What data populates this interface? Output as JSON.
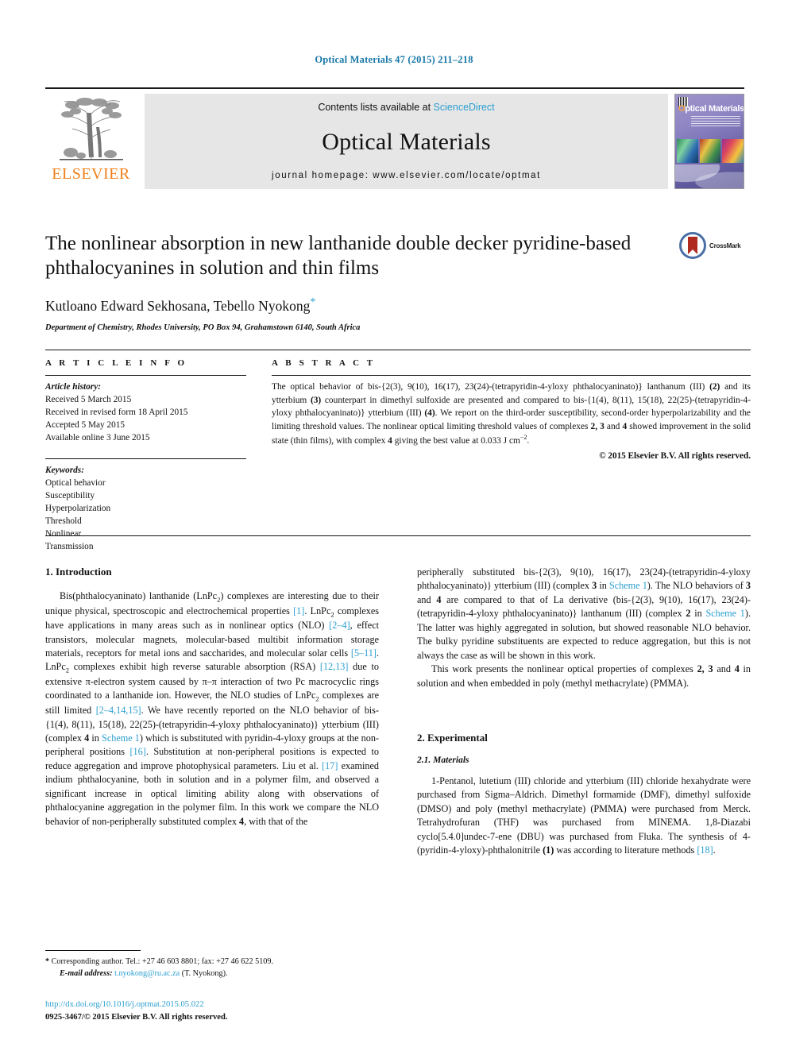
{
  "running_head": "Optical Materials 47 (2015) 211–218",
  "masthead": {
    "publisher_wordmark": "ELSEVIER",
    "contents_prefix": "Contents lists available at ",
    "contents_link": "ScienceDirect",
    "journal_name": "Optical Materials",
    "homepage_line": "journal homepage: www.elsevier.com/locate/optmat",
    "cover_title_o": "O",
    "cover_title_rest": "ptical Materials"
  },
  "crossmark": {
    "label": "CrossMark"
  },
  "title": "The nonlinear absorption in new lanthanide double decker pyridine-based phthalocyanines in solution and thin films",
  "authors": "Kutloano Edward Sekhosana, Tebello Nyokong",
  "affiliation": "Department of Chemistry, Rhodes University, PO Box 94, Grahamstown 6140, South Africa",
  "article_info": {
    "heading": "A R T I C L E   I N F O",
    "history_label": "Article history:",
    "history": [
      "Received 5 March 2015",
      "Received in revised form 18 April 2015",
      "Accepted 5 May 2015",
      "Available online 3 June 2015"
    ],
    "keywords_label": "Keywords:",
    "keywords": [
      "Optical behavior",
      "Susceptibility",
      "Hyperpolarization",
      "Threshold",
      "Nonlinear",
      "Transmission"
    ]
  },
  "abstract": {
    "heading": "A B S T R A C T",
    "text_1": "The optical behavior of bis-{2(3), 9(10), 16(17), 23(24)-(tetrapyridin-4-yloxy phthalocyaninato)} lanthanum (III) ",
    "bold_2": "(2)",
    "text_2": " and its ytterbium ",
    "bold_3": "(3)",
    "text_3": " counterpart in dimethyl sulfoxide are presented and compared to bis-{1(4), 8(11), 15(18), 22(25)-(tetrapyridin-4-yloxy phthalocyaninato)} ytterbium (III) ",
    "bold_4": "(4)",
    "text_4": ". We report on the third-order susceptibility, second-order hyperpolarizability and the limiting threshold values. The nonlinear optical limiting threshold values of complexes ",
    "bold_5": "2, 3",
    "text_5": " and ",
    "bold_6": "4",
    "text_6": " showed improvement in the solid state (thin films), with complex ",
    "bold_7": "4",
    "text_7": " giving the best value at 0.033 J cm",
    "sup_units": "−2",
    "text_8": ".",
    "copyright": "© 2015 Elsevier B.V. All rights reserved."
  },
  "sections": {
    "intro_heading": "1. Introduction",
    "experimental_heading": "2. Experimental",
    "materials_heading": "2.1. Materials"
  },
  "body": {
    "left_p1_a": "Bis(phthalocyaninato) lanthanide (LnPc",
    "left_p1_sub1": "2",
    "left_p1_b": ") complexes are interesting due to their unique physical, spectroscopic and electrochemical properties ",
    "left_p1_ref1": "[1]",
    "left_p1_c": ". LnPc",
    "left_p1_sub2": "2",
    "left_p1_d": " complexes have applications in many areas such as in nonlinear optics (NLO) ",
    "left_p1_ref2": "[2–4]",
    "left_p1_e": ", effect transistors, molecular magnets, molecular-based multibit information storage materials, receptors for metal ions and saccharides, and molecular solar cells ",
    "left_p1_ref3": "[5–11]",
    "left_p1_f": ". LnPc",
    "left_p1_sub3": "2",
    "left_p1_g": " complexes exhibit high reverse saturable absorption (RSA) ",
    "left_p1_ref4": "[12,13]",
    "left_p1_h": " due to extensive π-electron system caused by π–π interaction of two Pc macrocyclic rings coordinated to a lanthanide ion. However, the NLO studies of LnPc",
    "left_p1_sub4": "2",
    "left_p1_i": " complexes are still limited ",
    "left_p1_ref5": "[2–4,14,15]",
    "left_p1_j": ". We have recently reported on the NLO behavior of bis-{1(4), 8(11), 15(18), 22(25)-(tetrapyridin-4-yloxy phthalocyaninato)} ytterbium (III) (complex ",
    "left_p1_b4": "4",
    "left_p1_k": " in ",
    "left_p1_scheme1": "Scheme 1",
    "left_p1_l": ") which is substituted with pyridin-4-yloxy groups at the non-peripheral positions ",
    "left_p1_ref6": "[16]",
    "left_p1_m": ". Substitution at non-peripheral positions is expected to reduce aggregation and improve photophysical parameters. Liu et al. ",
    "left_p1_ref7": "[17]",
    "left_p1_n": " examined indium phthalocyanine, both in solution and in a polymer film, and observed a significant increase in optical limiting ability along with observations of phthalocyanine aggregation in the polymer film. In this work we compare the NLO behavior of non-peripherally substituted complex ",
    "left_p1_b4b": "4",
    "left_p1_o": ", with that of the",
    "right_p1_a": "peripherally substituted bis-{2(3), 9(10), 16(17), 23(24)-(tetrapyridin-4-yloxy phthalocyaninato)} ytterbium (III) (complex ",
    "right_p1_b3": "3",
    "right_p1_b": " in ",
    "right_p1_scheme1": "Scheme 1",
    "right_p1_c": "). The NLO behaviors of ",
    "right_p1_b3b": "3",
    "right_p1_d": " and ",
    "right_p1_b4": "4",
    "right_p1_e": " are compared to that of La derivative (bis-{2(3), 9(10), 16(17), 23(24)-(tetrapyridin-4-yloxy phthalocyaninato)} lanthanum (III) (complex ",
    "right_p1_b2": "2",
    "right_p1_f": " in ",
    "right_p1_scheme2": "Scheme 1",
    "right_p1_g": "). The latter was highly aggregated in solution, but showed reasonable NLO behavior. The bulky pyridine substituents are expected to reduce aggregation, but this is not always the case as will be shown in this work.",
    "right_p2_a": "This work presents the nonlinear optical properties of complexes ",
    "right_p2_b23": "2, 3",
    "right_p2_b": " and ",
    "right_p2_b4": "4",
    "right_p2_c": " in solution and when embedded in poly (methyl methacrylate) (PMMA).",
    "right_p3_a": "1-Pentanol, lutetium (III) chloride and ytterbium (III) chloride hexahydrate were purchased from Sigma–Aldrich. Dimethyl formamide (DMF), dimethyl sulfoxide (DMSO) and poly (methyl methacrylate) (PMMA) were purchased from Merck. Tetrahydrofuran (THF) was purchased from MINEMA. 1,8-Diazabi cyclo[5.4.0]undec-7-ene (DBU) was purchased from Fluka. The synthesis of 4-(pyridin-4-yloxy)-phthalonitrile ",
    "right_p3_b1": "(1)",
    "right_p3_b": " was according to literature methods ",
    "right_p3_ref": "[18]",
    "right_p3_c": "."
  },
  "footnote": {
    "star": "*",
    "corresponding": " Corresponding author. Tel.: +27 46 603 8801; fax: +27 46 622 5109.",
    "email_label": "E-mail address:",
    "email": "t.nyokong@ru.ac.za",
    "email_suffix": " (T. Nyokong)."
  },
  "imprint": {
    "doi": "http://dx.doi.org/10.1016/j.optmat.2015.05.022",
    "issn_line": "0925-3467/© 2015 Elsevier B.V. All rights reserved."
  },
  "colors": {
    "link": "#2a9fd0",
    "running_head": "#1878a8",
    "elsevier_orange": "#f07f1a",
    "band_gray": "#e6e6e6"
  }
}
